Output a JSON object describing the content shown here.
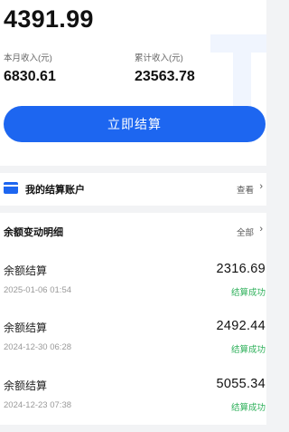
{
  "balance": "4391.99",
  "stats": {
    "month_income_label": "本月收入(元)",
    "month_income_value": "6830.61",
    "total_income_label": "累计收入(元)",
    "total_income_value": "23563.78"
  },
  "settle_button_label": "立即结算",
  "account": {
    "icon": "card-icon",
    "title": "我的结算账户",
    "view_label": "查看",
    "chevron": "›"
  },
  "details": {
    "title": "余额变动明细",
    "all_label": "全部",
    "chevron": "›",
    "transactions": [
      {
        "name": "余额结算",
        "time": "2025-01-06 01:54",
        "amount": "2316.69",
        "status": "结算成功"
      },
      {
        "name": "余额结算",
        "time": "2024-12-30 06:28",
        "amount": "2492.44",
        "status": "结算成功"
      },
      {
        "name": "余额结算",
        "time": "2024-12-23 07:38",
        "amount": "5055.34",
        "status": "结算成功"
      }
    ]
  },
  "colors": {
    "accent": "#1d66f0",
    "success": "#2eb05a",
    "background": "#f2f3f5"
  }
}
